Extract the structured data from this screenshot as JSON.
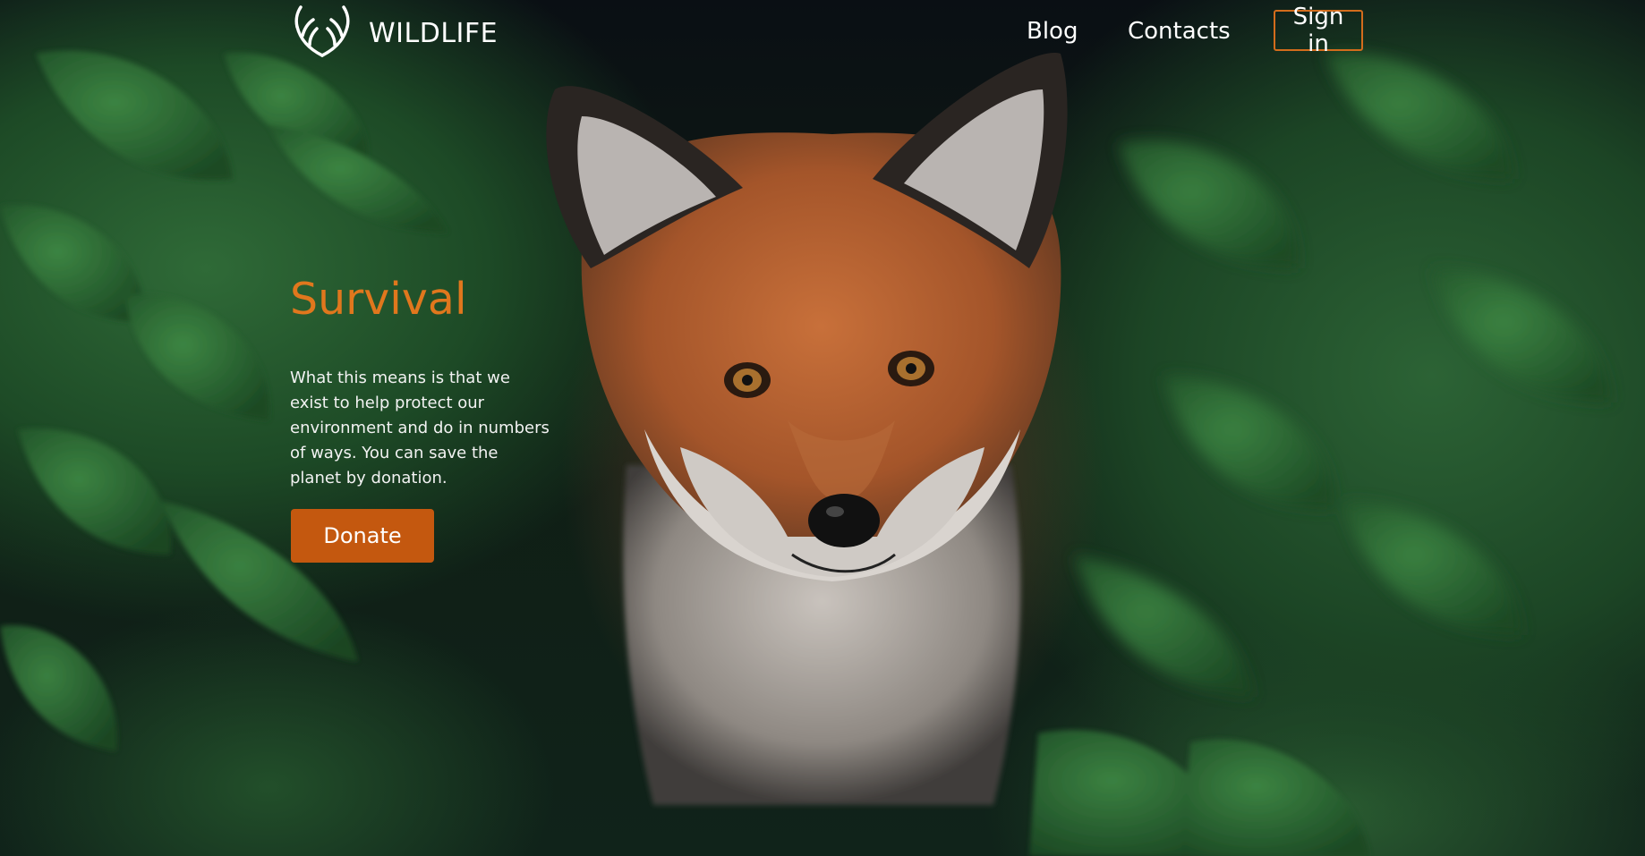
{
  "brand": {
    "logo_icon": "antlers-icon",
    "name": "WILDLIFE"
  },
  "nav": {
    "items": [
      {
        "label": "Blog"
      },
      {
        "label": "Contacts"
      }
    ],
    "signin_label": "Sign in"
  },
  "hero": {
    "heading": "Survival",
    "description": "What this means is that we exist to help protect our environment and do in numbers of ways. You can save the planet by donation.",
    "cta_label": "Donate"
  },
  "colors": {
    "accent": "#e0771d",
    "button": "#c4580f",
    "signin_border": "#d36c1c"
  }
}
